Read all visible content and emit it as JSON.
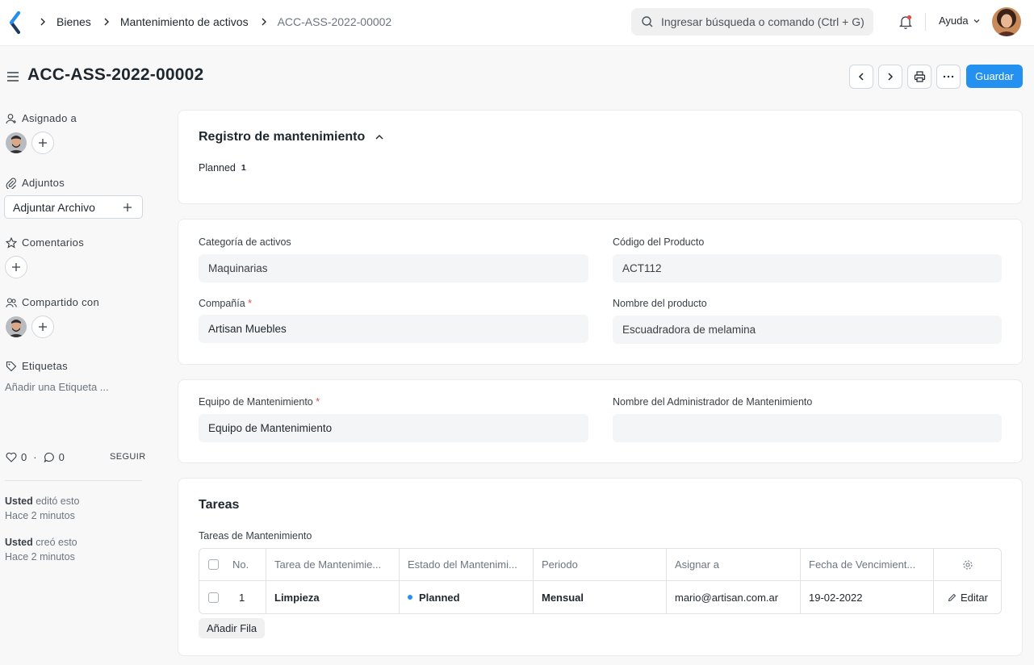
{
  "navbar": {
    "breadcrumbs": [
      "Bienes",
      "Mantenimiento de activos",
      "ACC-ASS-2022-00002"
    ],
    "search_placeholder": "Ingresar búsqueda o comando (Ctrl + G)",
    "help_label": "Ayuda"
  },
  "page": {
    "title": "ACC-ASS-2022-00002",
    "save_label": "Guardar"
  },
  "sidebar": {
    "assigned_label": "Asignado a",
    "attachments_label": "Adjuntos",
    "attach_button": "Adjuntar Archivo",
    "comments_label": "Comentarios",
    "shared_label": "Compartido con",
    "tags_label": "Etiquetas",
    "add_tag": "Añadir una Etiqueta ...",
    "likes": "0",
    "comments_count": "0",
    "follow_label": "SEGUIR",
    "activity": [
      {
        "user": "Usted",
        "action": "editó esto",
        "time": "Hace 2 minutos"
      },
      {
        "user": "Usted",
        "action": "creó esto",
        "time": "Hace 2 minutos"
      }
    ]
  },
  "maintenance_log": {
    "title": "Registro de mantenimiento",
    "status_label": "Planned",
    "status_count": "1"
  },
  "details": {
    "asset_category_label": "Categoría de activos",
    "asset_category": "Maquinarias",
    "item_code_label": "Código del Producto",
    "item_code": "ACT112",
    "company_label": "Compañía",
    "company": "Artisan Muebles",
    "item_name_label": "Nombre del producto",
    "item_name": "Escuadradora de melamina"
  },
  "team": {
    "team_label": "Equipo de Mantenimiento",
    "team": "Equipo de Mantenimiento",
    "manager_label": "Nombre del Administrador de Mantenimiento",
    "manager": ""
  },
  "tasks": {
    "title": "Tareas",
    "table_label": "Tareas de Mantenimiento",
    "columns": [
      "No.",
      "Tarea de Mantenimie...",
      "Estado del Mantenimi...",
      "Periodo",
      "Asignar a",
      "Fecha de Vencimient..."
    ],
    "rows": [
      {
        "no": "1",
        "task": "Limpieza",
        "status": "Planned",
        "period": "Mensual",
        "assign": "mario@artisan.com.ar",
        "due": "19-02-2022",
        "edit": "Editar"
      }
    ],
    "add_row": "Añadir Fila"
  }
}
